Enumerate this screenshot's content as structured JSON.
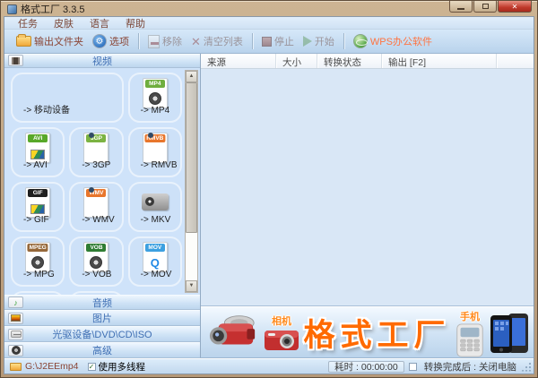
{
  "window": {
    "title": "格式工厂 3.3.5"
  },
  "menu": {
    "items": [
      "任务",
      "皮肤",
      "语言",
      "帮助"
    ]
  },
  "toolbar": {
    "output_folder": "输出文件夹",
    "options": "选项",
    "remove": "移除",
    "clear_list": "清空列表",
    "stop": "停止",
    "start": "开始",
    "wps": "WPS办公软件",
    "wps_color": "#ff7340"
  },
  "sidebar": {
    "video_header": "视频",
    "video_items": [
      {
        "label": "-> 移动设备"
      },
      {
        "label": "-> MP4",
        "badge": "MP4",
        "badge_color": "#6fae3f"
      },
      {
        "label": "-> AVI",
        "badge": "AVI",
        "badge_color": "#58a829"
      },
      {
        "label": "-> 3GP",
        "badge": "3GP",
        "badge_color": "#7cb342"
      },
      {
        "label": "-> RMVB",
        "badge": "RMVB",
        "badge_color": "#e8762c"
      },
      {
        "label": "-> GIF",
        "badge": "GIF",
        "badge_color": "#1f1f1f"
      },
      {
        "label": "-> WMV",
        "badge": "WMV",
        "badge_color": "#e8762c"
      },
      {
        "label": "-> MKV"
      },
      {
        "label": "-> MPG",
        "badge": "MPEG",
        "badge_color": "#96683a"
      },
      {
        "label": "-> VOB",
        "badge": "VOB",
        "badge_color": "#2f7d33"
      },
      {
        "label": "-> MOV",
        "badge": "MOV",
        "badge_color": "#3da0e0"
      }
    ],
    "sections": [
      "音频",
      "图片",
      "光驱设备\\DVD\\CD\\ISO",
      "高级"
    ]
  },
  "table": {
    "columns": [
      "来源",
      "大小",
      "转换状态",
      "输出 [F2]"
    ]
  },
  "banner": {
    "camera_label": "相机",
    "logo": "格式工厂",
    "phone_label": "手机",
    "logo_color": "#ff6a00"
  },
  "statusbar": {
    "path": "G:\\J2EEmp4",
    "multithread": "使用多线程",
    "elapsed": "耗时 : 00:00:00",
    "after_done": "转换完成后 : 关闭电脑"
  }
}
